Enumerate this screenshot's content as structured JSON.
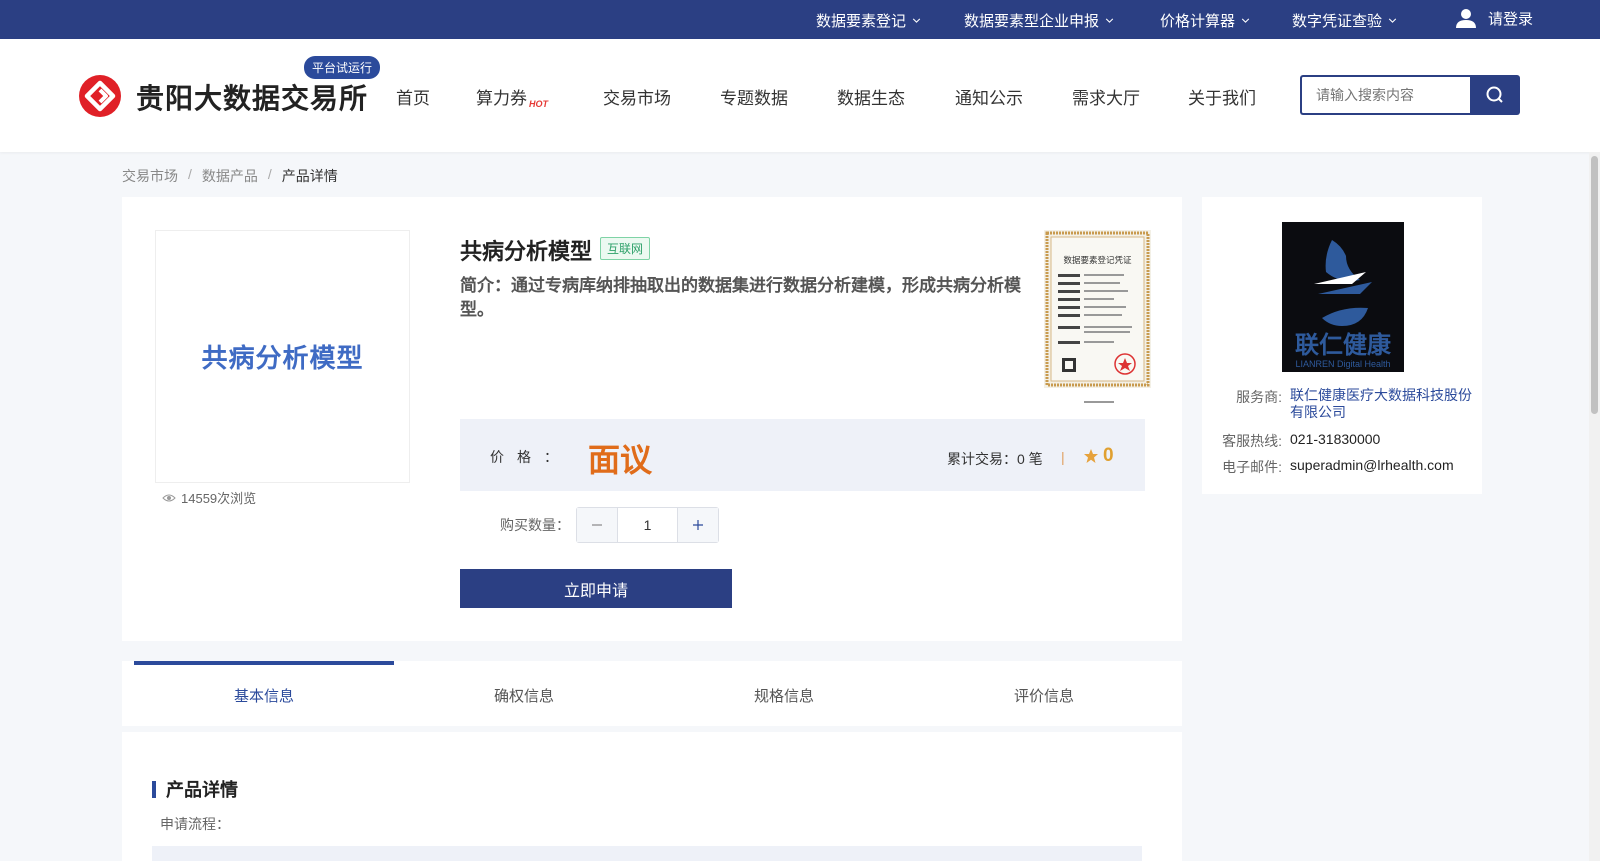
{
  "topbar": {
    "items": [
      {
        "label": "数据要素登记"
      },
      {
        "label": "数据要素型企业申报"
      },
      {
        "label": "价格计算器"
      },
      {
        "label": "数字凭证查验"
      }
    ],
    "login_label": "请登录"
  },
  "header": {
    "logo_text": "贵阳大数据交易所",
    "trial_badge": "平台试运行",
    "nav": [
      {
        "label": "首页"
      },
      {
        "label": "算力券",
        "hot": "HOT"
      },
      {
        "label": "交易市场"
      },
      {
        "label": "专题数据"
      },
      {
        "label": "数据生态"
      },
      {
        "label": "通知公示"
      },
      {
        "label": "需求大厅"
      },
      {
        "label": "关于我们"
      }
    ],
    "search_placeholder": "请输入搜索内容"
  },
  "breadcrumb": [
    "交易市场",
    "数据产品",
    "产品详情"
  ],
  "product": {
    "thumb_text": "共病分析模型",
    "views": "14559次浏览",
    "title": "共病分析模型",
    "tag": "互联网",
    "intro": "简介：通过专病库纳排抽取出的数据集进行数据分析建模，形成共病分析模型。",
    "cert_title": "数据要素登记凭证",
    "price_label": "价格：",
    "price_value": "面议",
    "trade_count": "累计交易：0 笔",
    "rating": "0",
    "qty_label": "购买数量：",
    "qty_value": "1",
    "apply_label": "立即申请"
  },
  "provider": {
    "logo_text_cn": "联仁健康",
    "logo_text_en": "LIANREN Digital Health",
    "rows": [
      {
        "label": "服务商:",
        "value": "联仁健康医疗大数据科技股份有限公司"
      },
      {
        "label": "客服热线:",
        "value": "021-31830000"
      },
      {
        "label": "电子邮件:",
        "value": "superadmin@lrhealth.com"
      }
    ]
  },
  "tabs": [
    {
      "label": "基本信息"
    },
    {
      "label": "确权信息"
    },
    {
      "label": "规格信息"
    },
    {
      "label": "评价信息"
    }
  ],
  "detail": {
    "title": "产品详情",
    "subtitle": "申请流程："
  },
  "colors": {
    "brand": "#2b3f83",
    "price": "#e06c1a",
    "tag_green": "#2ea16a"
  }
}
